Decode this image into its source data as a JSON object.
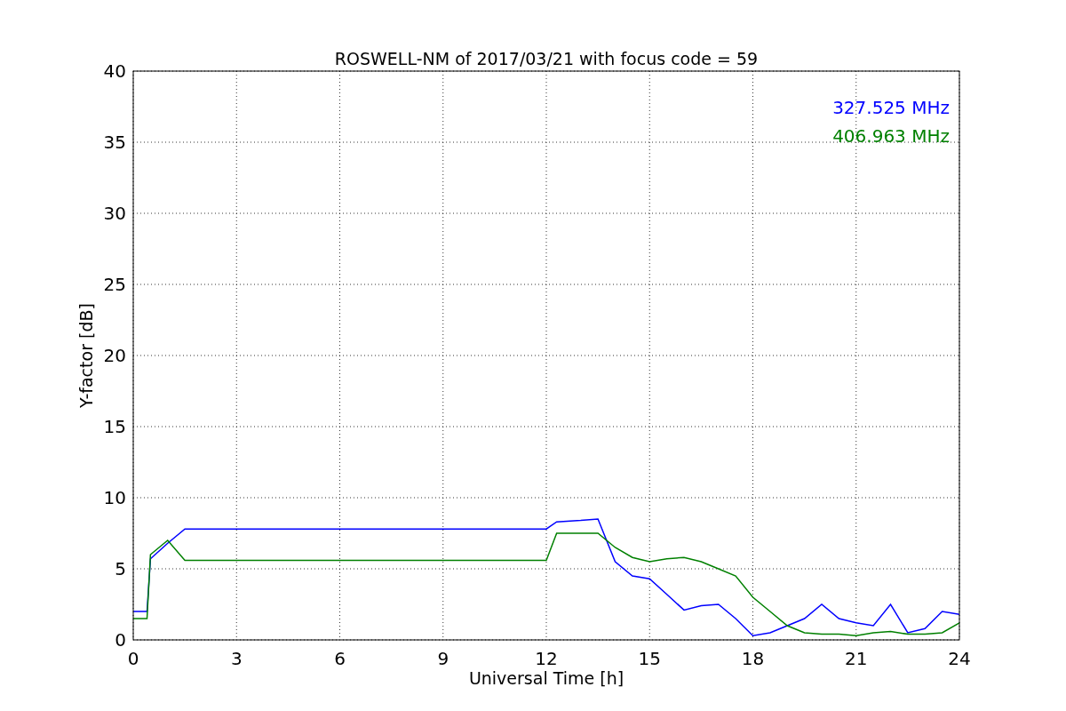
{
  "chart_data": {
    "type": "line",
    "title": "ROSWELL-NM of 2017/03/21 with focus code = 59",
    "xlabel": "Universal Time [h]",
    "ylabel": "Y-factor [dB]",
    "x": [
      0,
      0.4,
      0.5,
      1,
      1.5,
      3,
      6,
      9,
      12,
      12.3,
      13,
      13.5,
      14,
      14.5,
      15,
      15.5,
      16,
      16.5,
      17,
      17.5,
      18,
      18.5,
      19,
      19.5,
      20,
      20.5,
      21,
      21.5,
      22,
      22.5,
      23,
      23.5,
      24
    ],
    "series": [
      {
        "name": "327.525 MHz",
        "color": "#0000ff",
        "values": [
          2,
          2,
          5.7,
          6.8,
          7.8,
          7.8,
          7.8,
          7.8,
          7.8,
          8.3,
          8.4,
          8.5,
          5.5,
          4.5,
          4.3,
          3.2,
          2.1,
          2.4,
          2.5,
          1.5,
          0.3,
          0.5,
          1,
          1.5,
          2.5,
          1.5,
          1.2,
          1,
          2.5,
          0.5,
          0.8,
          2,
          1.8
        ]
      },
      {
        "name": "406.963 MHz",
        "color": "#008000",
        "values": [
          1.5,
          1.5,
          6,
          7,
          5.6,
          5.6,
          5.6,
          5.6,
          5.6,
          7.5,
          7.5,
          7.5,
          6.5,
          5.8,
          5.5,
          5.7,
          5.8,
          5.5,
          5,
          4.5,
          3,
          2,
          1,
          0.5,
          0.4,
          0.4,
          0.3,
          0.5,
          0.6,
          0.4,
          0.4,
          0.5,
          1.2
        ]
      }
    ],
    "xlim": [
      0,
      24
    ],
    "ylim": [
      0,
      40
    ],
    "xticks": [
      0,
      3,
      6,
      9,
      12,
      15,
      18,
      21,
      24
    ],
    "yticks": [
      0,
      5,
      10,
      15,
      20,
      25,
      30,
      35,
      40
    ],
    "grid": true
  }
}
